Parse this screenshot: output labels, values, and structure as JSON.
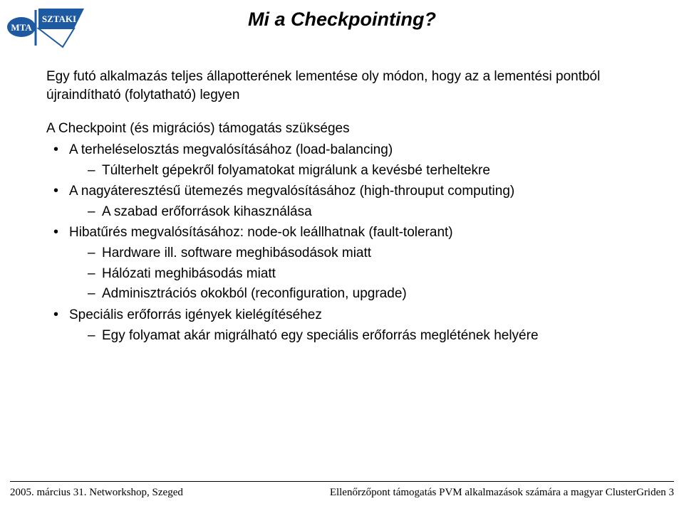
{
  "title": "Mi a Checkpointing?",
  "logo": {
    "left_text": "MTA",
    "right_text": "SZTAKI",
    "left_fill": "#1d5aa2",
    "right_fill": "#1d5aa2"
  },
  "intro": "Egy futó alkalmazás teljes állapotterének lementése oly módon, hogy az a lementési pontból újraindítható (folytatható) legyen",
  "sub_heading": "A Checkpoint (és migrációs) támogatás szükséges",
  "bullets": [
    {
      "text": "A terheléselosztás megvalósításához (load-balancing)",
      "children": [
        {
          "text": "Túlterhelt gépekről folyamatokat migrálunk a kevésbé terheltekre"
        }
      ]
    },
    {
      "text": "A nagyáteresztésű ütemezés megvalósításához (high-throuput computing)",
      "children": [
        {
          "text": "A szabad erőforrások kihasználása"
        }
      ]
    },
    {
      "text": "Hibatűrés megvalósításához: node-ok leállhatnak (fault-tolerant)",
      "children": [
        {
          "text": "Hardware ill. software meghibásodások miatt"
        },
        {
          "text": "Hálózati meghibásodás miatt"
        },
        {
          "text": "Adminisztrációs okokból (reconfiguration, upgrade)"
        }
      ]
    },
    {
      "text": "Speciális erőforrás igények kielégítéséhez",
      "children": [
        {
          "text": "Egy folyamat akár migrálható egy speciális erőforrás meglétének helyére"
        }
      ]
    }
  ],
  "footer": {
    "left": "2005. március 31. Networkshop, Szeged",
    "right": "Ellenőrzőpont támogatás PVM alkalmazások számára a magyar ClusterGriden 3"
  }
}
